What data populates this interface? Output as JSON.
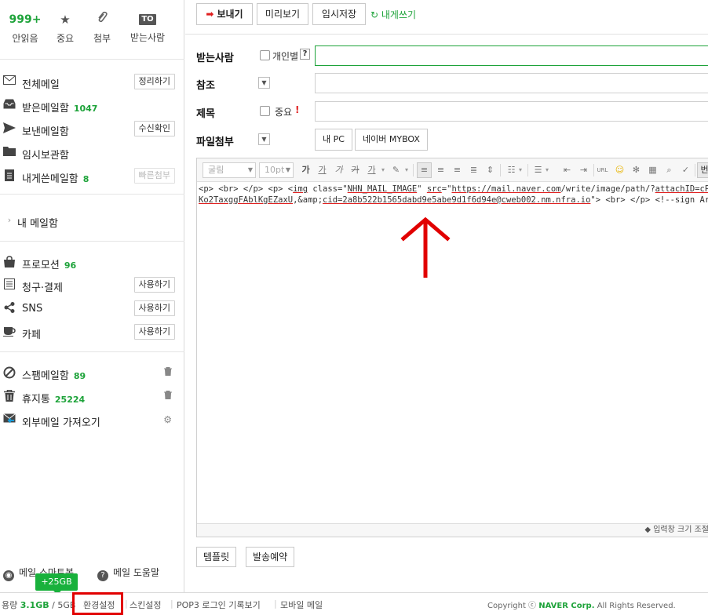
{
  "quick": {
    "unread": {
      "count": "999+",
      "label": "안읽음"
    },
    "important": {
      "icon": "star-icon",
      "label": "중요"
    },
    "attachment": {
      "icon": "paperclip-icon",
      "label": "첨부"
    },
    "to_me": {
      "badge": "TO",
      "label": "받는사람"
    }
  },
  "mailboxes": {
    "all": {
      "label": "전체메일",
      "action": "정리하기"
    },
    "inbox": {
      "label": "받은메일함",
      "count": "1047"
    },
    "sent": {
      "label": "보낸메일함",
      "action": "수신확인"
    },
    "drafts": {
      "label": "임시보관함"
    },
    "to_self": {
      "label": "내게쓴메일함",
      "count": "8",
      "action": "빠른첨부"
    }
  },
  "my_mailbox": "내 메일함",
  "categories": {
    "promotion": {
      "label": "프로모션",
      "count": "96"
    },
    "billing": {
      "label": "청구·결제",
      "action": "사용하기"
    },
    "sns": {
      "label": "SNS",
      "action": "사용하기"
    },
    "cafe": {
      "label": "카페",
      "action": "사용하기"
    }
  },
  "special": {
    "spam": {
      "label": "스팸메일함",
      "count": "89"
    },
    "trash": {
      "label": "휴지통",
      "count": "25224"
    },
    "external": {
      "label": "외부메일 가져오기"
    }
  },
  "sidebar_bottom": {
    "smart_bot": "메일 스마트봇",
    "help": "메일 도움말",
    "tooltip": "+25GB"
  },
  "toolbar": {
    "send": "보내기",
    "preview": "미리보기",
    "save_draft": "임시저장",
    "to_self": "내게쓰기"
  },
  "form": {
    "recipient_label": "받는사람",
    "individual_label": "개인별",
    "help_mark": "?",
    "cc_label": "참조",
    "subject_label": "제목",
    "important_label": "중요",
    "important_mark": "!",
    "attach_label": "파일첨부",
    "my_pc": "내 PC",
    "mybox": "네이버 MYBOX"
  },
  "editor": {
    "font": "굴림",
    "size": "10pt",
    "bold": "가",
    "underline": "가",
    "italic": "가",
    "strike": "가",
    "font_color": "가",
    "lang": "번",
    "code_line1_pre": "<p> <br> </p> <p> <",
    "code_line1_img": "img",
    "code_line1_mid": " class=\"",
    "code_line1_class": "NHN_MAIL_IMAGE",
    "code_line1_mid2": "\" ",
    "code_line1_src": "src",
    "code_line1_mid3": "=\"",
    "code_line1_url": "https://mail.naver.com",
    "code_line1_path": "/write/image/path/?",
    "code_line1_attach": "attachID=cPKgKA",
    "code_line2_id": "Ko2TaxggFAblKgEZaxU",
    "code_line2_mid": ",&amp;",
    "code_line2_cid": "cid=2a8b522b1565dabd9e5abe9d1f6d94e@cweb002.nm.nfra.io",
    "code_line2_end": "\"> <br> </p> <!--sign Area",
    "resize": "◆ 입력창 크기 조절"
  },
  "bottom_buttons": {
    "template": "템플릿",
    "schedule": "발송예약"
  },
  "footer": {
    "usage_label": "용량",
    "usage_value": "3.1GB",
    "usage_total": "/ 5GB",
    "settings": "환경설정",
    "skin": "스킨설정",
    "pop3": "POP3 로그인 기록보기",
    "mobile": "모바일 메일",
    "copyright_pre": "Copyright ⓒ",
    "copyright_brand": "NAVER Corp.",
    "copyright_post": "All Rights Reserved."
  },
  "colors": {
    "accent_green": "#1ea33a",
    "highlight_red": "#e10000"
  }
}
